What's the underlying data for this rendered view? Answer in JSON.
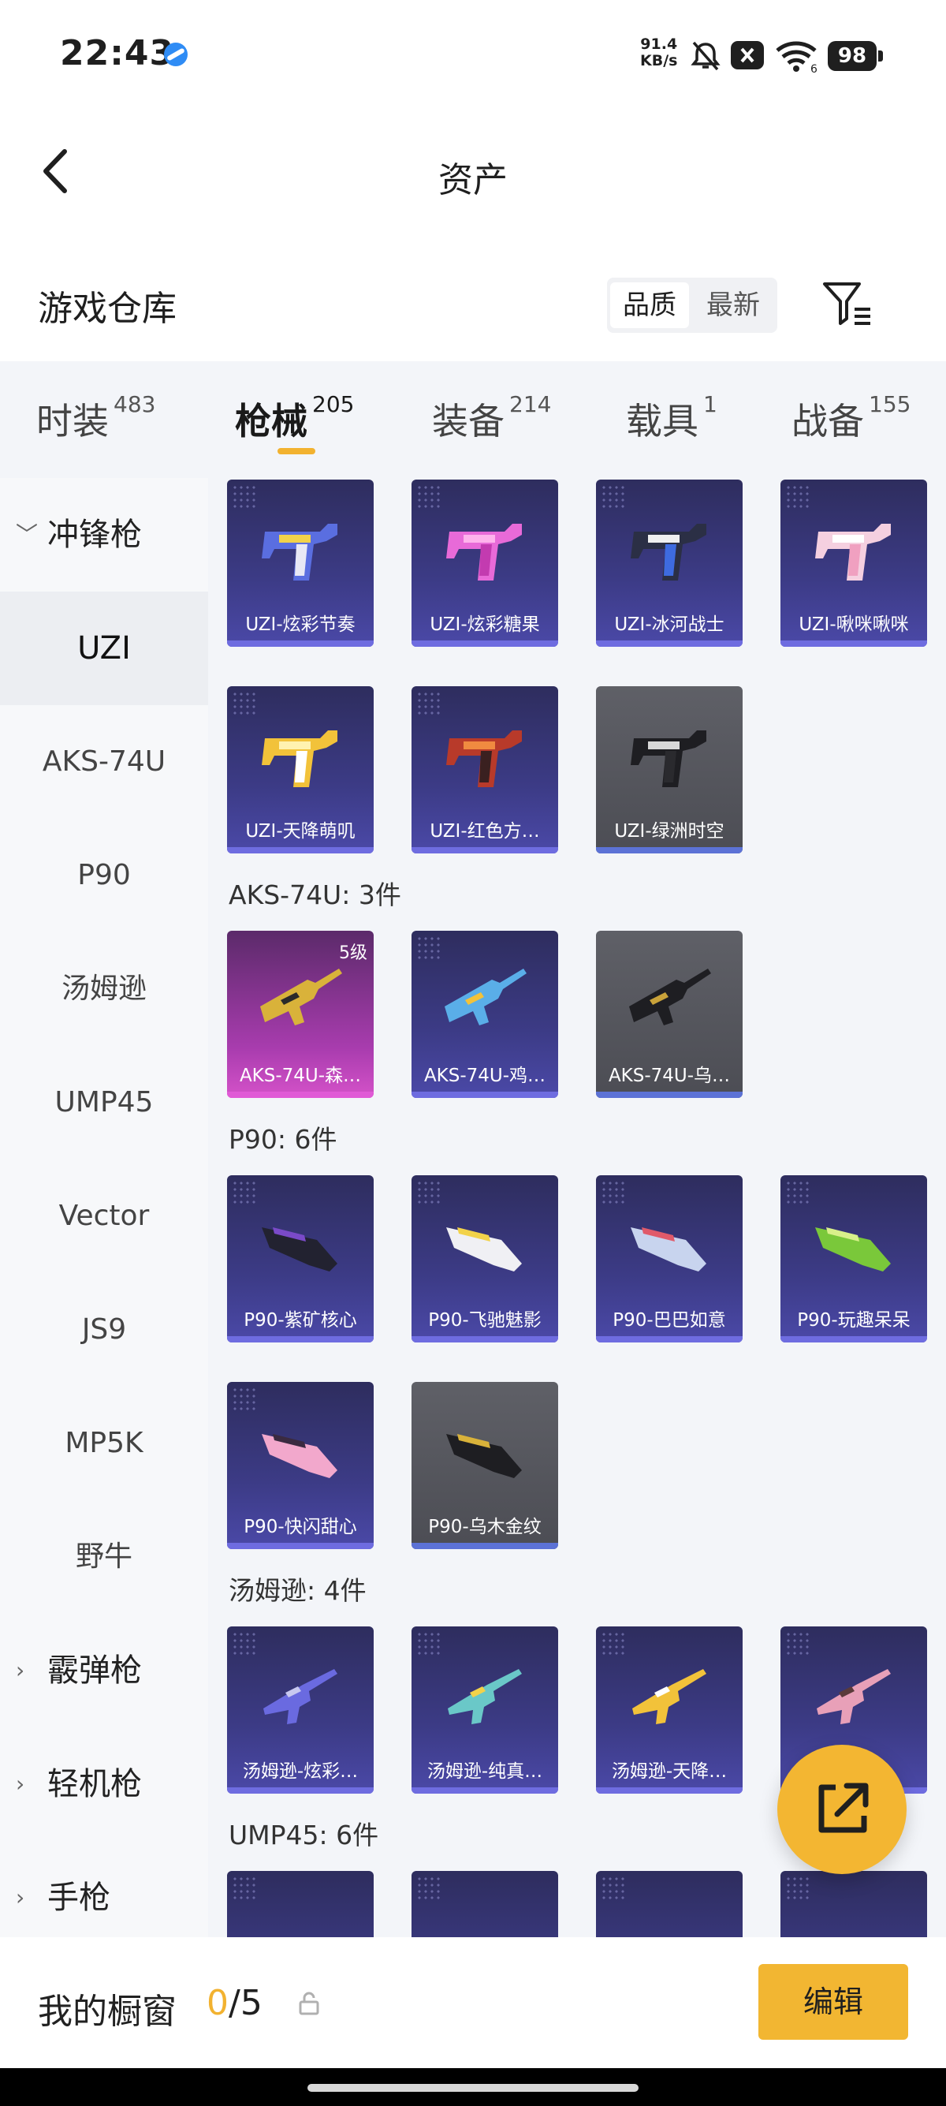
{
  "status": {
    "time": "22:43",
    "speed_value": "91.4",
    "speed_unit": "KB/s",
    "battery": "98",
    "wifi_label": "6"
  },
  "header": {
    "title": "资产"
  },
  "warehouse": {
    "title": "游戏仓库",
    "sort_quality": "品质",
    "sort_newest": "最新"
  },
  "tabs": [
    {
      "label": "时装",
      "count": "483"
    },
    {
      "label": "枪械",
      "count": "205"
    },
    {
      "label": "装备",
      "count": "214"
    },
    {
      "label": "载具",
      "count": "1"
    },
    {
      "label": "战备",
      "count": "155"
    }
  ],
  "sidebar": {
    "cat1": "冲锋枪",
    "items": [
      "UZI",
      "AKS-74U",
      "P90",
      "汤姆逊",
      "UMP45",
      "Vector",
      "JS9",
      "MP5K",
      "野牛"
    ],
    "cat2": "霰弹枪",
    "cat3": "轻机枪",
    "cat4": "手枪"
  },
  "sections": {
    "aks": "AKS-74U: 3件",
    "p90": "P90: 6件",
    "tommy": "汤姆逊: 4件",
    "ump": "UMP45: 6件"
  },
  "cards": {
    "uzi": [
      "UZI-炫彩节奏",
      "UZI-炫彩糖果",
      "UZI-冰河战士",
      "UZI-啾咪啾咪",
      "UZI-天降萌叽",
      "UZI-红色方…",
      "UZI-绿洲时空"
    ],
    "aks": [
      "AKS-74U-森…",
      "AKS-74U-鸡…",
      "AKS-74U-乌…"
    ],
    "aks_level": "5级",
    "p90": [
      "P90-紫矿核心",
      "P90-飞驰魅影",
      "P90-巴巴如意",
      "P90-玩趣呆呆",
      "P90-快闪甜心",
      "P90-乌木金纹"
    ],
    "tommy": [
      "汤姆逊-炫彩…",
      "汤姆逊-纯真…",
      "汤姆逊-天降…",
      "…"
    ]
  },
  "bottom": {
    "showcase": "我的橱窗",
    "count_current": "0",
    "count_total": "/5",
    "edit": "编辑"
  },
  "colors": {
    "accent": "#f2b632",
    "card_purple": "#3c3b86",
    "card_gray": "#55565d",
    "card_pink": "#c64bc2"
  }
}
